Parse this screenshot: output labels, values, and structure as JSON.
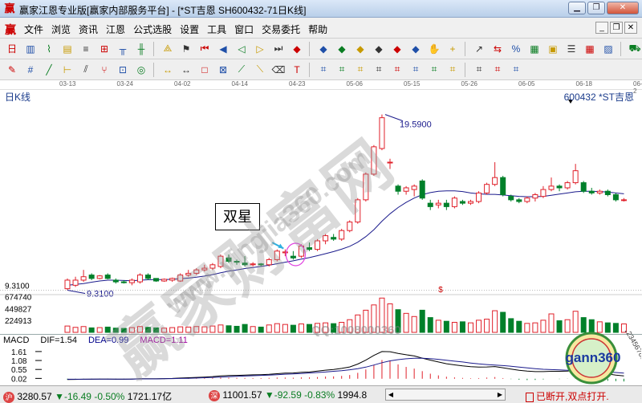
{
  "window": {
    "title": "赢家江恩专业版[赢家内部服务平台] - [*ST吉恩  SH600432-71日K线]",
    "app_icon": "赢"
  },
  "menu": {
    "logo": "赢",
    "items": [
      "文件",
      "浏览",
      "资讯",
      "江恩",
      "公式选股",
      "设置",
      "工具",
      "窗口",
      "交易委托",
      "帮助"
    ]
  },
  "toolbar1_icons": [
    "period-selector-icon",
    "candle-icon",
    "line-chart-icon",
    "indicator-icon",
    "stack-icon",
    "multi-chart-icon",
    "tower-icon",
    "bar-icon",
    "gann-fan-icon",
    "flag-icon",
    "first-icon",
    "prev-icon",
    "play-back-icon",
    "play-icon",
    "next-icon",
    "diamond-icon",
    "diamond-icon",
    "diamond-icon",
    "diamond-icon",
    "diamond-icon",
    "diamond-icon",
    "diamond-icon",
    "hand-icon",
    "crosshair-icon",
    "trend-icon",
    "compare-icon",
    "percent-icon",
    "calculator-icon",
    "report-icon",
    "list-icon",
    "table-icon",
    "chart-icon",
    "truck-icon"
  ],
  "toolbar2_icons": [
    "pencil-icon",
    "grid-icon",
    "line-tool-icon",
    "ruler-icon",
    "channel-icon",
    "fork-icon",
    "gann-square-icon",
    "circle-grid-icon",
    "arrow-tool-icon",
    "arrow-tool-icon",
    "square-icon",
    "gann-box-icon",
    "fan-icon",
    "diagonal-icon",
    "eraser-icon",
    "text-icon",
    "draw-icon",
    "draw-icon",
    "draw-icon",
    "draw-icon",
    "draw-icon",
    "draw-icon",
    "draw-icon",
    "draw-icon",
    "draw-icon",
    "draw-icon",
    "draw-icon"
  ],
  "dates": [
    "03-13",
    "03-24",
    "04-02",
    "04-14",
    "04-23",
    "05-06",
    "05-15",
    "05-26",
    "06-05",
    "06-18",
    "06-2"
  ],
  "chart_header": {
    "period_label": "日K线",
    "stock_label": "600432 *ST吉恩"
  },
  "price_labels": {
    "high": "19.5900",
    "low": "9.3100",
    "axis_low": "9.3100",
    "marker": "$"
  },
  "volume_axis": [
    "674740",
    "449827",
    "224913"
  ],
  "annotation": "双星",
  "macd": {
    "name": "MACD",
    "dif": "DIF=1.54",
    "dea": "DEA=0.99",
    "macd": "MACD=1.11",
    "axis": [
      "1.61",
      "1.08",
      "0.55",
      "0.02"
    ]
  },
  "status": {
    "sh_index": "3280.57",
    "sh_change": "▼-16.49",
    "sh_pct": "-0.50%",
    "sh_amount": "1721.17亿",
    "sz_index": "11001.57",
    "sz_change": "▼-92.59",
    "sz_pct": "-0.83%",
    "sz_amount": "1994.8",
    "connection": "已断开,双点打开.",
    "sh_icon": "沪",
    "sz_icon": "深"
  },
  "watermarks": {
    "brand": "赢家财富网",
    "url": "www.yingjia360.com",
    "qq": "QQ:1008000360"
  },
  "logo": {
    "text": "gann360",
    "ring_text": "123456789"
  },
  "colors": {
    "up": "#e0202a",
    "down": "#00802a",
    "ma_line": "#1b1b8c",
    "macd_dea": "#1b1b8c",
    "macd_dif": "#000000",
    "macd_bar_pos": "#e0202a",
    "macd_bar_neg": "#00802a",
    "highlight_circle": "#e040e0",
    "arrow": "#30b0e0"
  },
  "chart_data": {
    "type": "candlestick",
    "title": "*ST吉恩 SH600432 日K线",
    "candles": [
      {
        "o": 9.4,
        "c": 9.9,
        "h": 10.0,
        "l": 9.31
      },
      {
        "o": 9.6,
        "c": 9.9,
        "h": 10.1,
        "l": 9.5
      },
      {
        "o": 9.9,
        "c": 10.1,
        "h": 10.5,
        "l": 9.8
      },
      {
        "o": 10.2,
        "c": 10.0,
        "h": 10.3,
        "l": 9.9
      },
      {
        "o": 10.0,
        "c": 10.15,
        "h": 10.2,
        "l": 9.95
      },
      {
        "o": 10.2,
        "c": 10.0,
        "h": 10.3,
        "l": 9.95
      },
      {
        "o": 9.9,
        "c": 9.8,
        "h": 10.0,
        "l": 9.7
      },
      {
        "o": 9.8,
        "c": 9.75,
        "h": 9.9,
        "l": 9.7
      },
      {
        "o": 9.75,
        "c": 9.9,
        "h": 10.0,
        "l": 9.6
      },
      {
        "o": 9.8,
        "c": 10.2,
        "h": 10.3,
        "l": 9.7
      },
      {
        "o": 10.2,
        "c": 10.0,
        "h": 10.3,
        "l": 9.9
      },
      {
        "o": 10.0,
        "c": 9.85,
        "h": 10.0,
        "l": 9.8
      },
      {
        "o": 9.85,
        "c": 9.95,
        "h": 10.0,
        "l": 9.8
      },
      {
        "o": 9.9,
        "c": 10.0,
        "h": 10.05,
        "l": 9.8
      },
      {
        "o": 9.85,
        "c": 10.2,
        "h": 10.3,
        "l": 9.8
      },
      {
        "o": 10.2,
        "c": 10.3,
        "h": 10.5,
        "l": 10.1
      },
      {
        "o": 10.3,
        "c": 10.5,
        "h": 10.6,
        "l": 10.2
      },
      {
        "o": 10.5,
        "c": 10.6,
        "h": 10.8,
        "l": 10.4
      },
      {
        "o": 10.6,
        "c": 10.8,
        "h": 10.9,
        "l": 10.5
      },
      {
        "o": 10.7,
        "c": 11.3,
        "h": 11.4,
        "l": 10.6
      },
      {
        "o": 11.2,
        "c": 11.0,
        "h": 11.4,
        "l": 10.9
      },
      {
        "o": 11.0,
        "c": 10.95,
        "h": 11.1,
        "l": 10.8
      },
      {
        "o": 10.9,
        "c": 10.8,
        "h": 11.3,
        "l": 10.7
      },
      {
        "o": 10.8,
        "c": 10.85,
        "h": 10.95,
        "l": 10.7
      },
      {
        "o": 10.85,
        "c": 10.8,
        "h": 10.9,
        "l": 10.7
      },
      {
        "o": 10.8,
        "c": 11.1,
        "h": 11.2,
        "l": 10.7
      },
      {
        "o": 11.1,
        "c": 11.6,
        "h": 11.7,
        "l": 11.0
      },
      {
        "o": 11.5,
        "c": 11.55,
        "h": 11.7,
        "l": 11.3
      },
      {
        "o": 11.3,
        "c": 11.2,
        "h": 11.6,
        "l": 11.1
      },
      {
        "o": 11.3,
        "c": 11.9,
        "h": 12.0,
        "l": 11.2
      },
      {
        "o": 11.8,
        "c": 11.7,
        "h": 12.1,
        "l": 11.6
      },
      {
        "o": 11.7,
        "c": 12.2,
        "h": 12.3,
        "l": 11.6
      },
      {
        "o": 12.2,
        "c": 12.5,
        "h": 12.6,
        "l": 12.0
      },
      {
        "o": 12.4,
        "c": 12.3,
        "h": 12.6,
        "l": 12.2
      },
      {
        "o": 12.3,
        "c": 12.8,
        "h": 12.9,
        "l": 12.2
      },
      {
        "o": 12.8,
        "c": 13.3,
        "h": 13.4,
        "l": 12.7
      },
      {
        "o": 13.3,
        "c": 14.6,
        "h": 14.7,
        "l": 13.2
      },
      {
        "o": 14.6,
        "c": 16.1,
        "h": 16.2,
        "l": 14.5
      },
      {
        "o": 16.1,
        "c": 17.7,
        "h": 17.8,
        "l": 16.0
      },
      {
        "o": 17.6,
        "c": 19.4,
        "h": 19.59,
        "l": 17.5
      },
      {
        "o": 16.8,
        "c": 16.8,
        "h": 17.0,
        "l": 16.4
      },
      {
        "o": 15.4,
        "c": 15.1,
        "h": 15.5,
        "l": 14.9
      },
      {
        "o": 15.1,
        "c": 15.3,
        "h": 15.4,
        "l": 14.9
      },
      {
        "o": 15.2,
        "c": 15.4,
        "h": 15.5,
        "l": 14.8
      },
      {
        "o": 15.7,
        "c": 14.7,
        "h": 15.8,
        "l": 14.6
      },
      {
        "o": 14.4,
        "c": 14.2,
        "h": 14.6,
        "l": 14.0
      },
      {
        "o": 14.3,
        "c": 14.4,
        "h": 14.6,
        "l": 14.1
      },
      {
        "o": 14.4,
        "c": 14.2,
        "h": 14.6,
        "l": 14.0
      },
      {
        "o": 14.2,
        "c": 14.7,
        "h": 14.8,
        "l": 14.1
      },
      {
        "o": 14.5,
        "c": 14.4,
        "h": 14.6,
        "l": 14.3
      },
      {
        "o": 14.4,
        "c": 14.5,
        "h": 14.6,
        "l": 14.3
      },
      {
        "o": 14.5,
        "c": 15.0,
        "h": 15.1,
        "l": 14.4
      },
      {
        "o": 15.0,
        "c": 15.5,
        "h": 15.6,
        "l": 14.9
      },
      {
        "o": 15.5,
        "c": 15.9,
        "h": 16.8,
        "l": 15.4
      },
      {
        "o": 15.9,
        "c": 14.9,
        "h": 16.0,
        "l": 14.8
      },
      {
        "o": 14.8,
        "c": 14.6,
        "h": 14.9,
        "l": 14.5
      },
      {
        "o": 14.6,
        "c": 14.5,
        "h": 14.7,
        "l": 14.4
      },
      {
        "o": 14.5,
        "c": 14.7,
        "h": 14.8,
        "l": 14.4
      },
      {
        "o": 14.7,
        "c": 14.9,
        "h": 15.0,
        "l": 14.5
      },
      {
        "o": 14.8,
        "c": 15.2,
        "h": 15.4,
        "l": 14.7
      },
      {
        "o": 15.2,
        "c": 15.4,
        "h": 15.9,
        "l": 15.1
      },
      {
        "o": 15.4,
        "c": 15.3,
        "h": 15.5,
        "l": 15.1
      },
      {
        "o": 15.3,
        "c": 15.6,
        "h": 15.7,
        "l": 15.2
      },
      {
        "o": 15.6,
        "c": 16.3,
        "h": 16.7,
        "l": 15.5
      },
      {
        "o": 15.6,
        "c": 15.1,
        "h": 15.7,
        "l": 15.0
      },
      {
        "o": 15.1,
        "c": 15.0,
        "h": 15.3,
        "l": 14.9
      },
      {
        "o": 15.0,
        "c": 15.1,
        "h": 15.2,
        "l": 14.9
      },
      {
        "o": 15.1,
        "c": 14.9,
        "h": 15.2,
        "l": 14.8
      },
      {
        "o": 14.9,
        "c": 14.6,
        "h": 15.0,
        "l": 14.5
      },
      {
        "o": 14.6,
        "c": 14.6,
        "h": 14.7,
        "l": 14.5
      }
    ],
    "volume": [
      120000,
      95000,
      110000,
      85000,
      90000,
      100000,
      80000,
      75000,
      90000,
      110000,
      95000,
      85000,
      80000,
      90000,
      105000,
      100000,
      110000,
      105000,
      120000,
      140000,
      125000,
      115000,
      150000,
      110000,
      100000,
      140000,
      165000,
      150000,
      135000,
      160000,
      150000,
      170000,
      180000,
      165000,
      190000,
      240000,
      330000,
      420000,
      520000,
      650000,
      540000,
      430000,
      360000,
      300000,
      420000,
      280000,
      230000,
      210000,
      190000,
      200000,
      180000,
      230000,
      250000,
      410000,
      380000,
      260000,
      210000,
      170000,
      180000,
      230000,
      350000,
      220000,
      240000,
      400000,
      280000,
      240000,
      200000,
      180000,
      170000,
      160000
    ],
    "macd_bars": [
      -0.05,
      -0.04,
      -0.03,
      -0.04,
      -0.03,
      -0.04,
      -0.05,
      -0.04,
      -0.03,
      -0.02,
      -0.02,
      -0.03,
      -0.02,
      -0.01,
      0.01,
      0.02,
      0.03,
      0.04,
      0.05,
      0.07,
      0.06,
      0.05,
      0.05,
      0.04,
      0.04,
      0.05,
      0.07,
      0.07,
      0.06,
      0.08,
      0.08,
      0.1,
      0.13,
      0.14,
      0.17,
      0.22,
      0.35,
      0.55,
      0.8,
      1.11,
      1.05,
      0.85,
      0.7,
      0.6,
      0.45,
      0.3,
      0.2,
      0.12,
      0.08,
      0.05,
      0.03,
      0.04,
      0.07,
      0.1,
      0.04,
      -0.02,
      -0.06,
      -0.08,
      -0.07,
      -0.04,
      0.0,
      -0.02,
      -0.01,
      0.05,
      -0.02,
      -0.06,
      -0.09,
      -0.12,
      -0.14,
      -0.16
    ],
    "dif": [
      -0.05,
      -0.04,
      -0.03,
      -0.03,
      -0.02,
      -0.02,
      -0.03,
      -0.03,
      -0.02,
      0.0,
      0.0,
      0.0,
      0.01,
      0.02,
      0.04,
      0.06,
      0.08,
      0.1,
      0.13,
      0.17,
      0.19,
      0.2,
      0.22,
      0.23,
      0.24,
      0.26,
      0.3,
      0.33,
      0.34,
      0.38,
      0.4,
      0.45,
      0.51,
      0.55,
      0.61,
      0.7,
      0.87,
      1.1,
      1.38,
      1.61,
      1.6,
      1.5,
      1.42,
      1.35,
      1.22,
      1.1,
      0.99,
      0.89,
      0.82,
      0.76,
      0.71,
      0.69,
      0.7,
      0.72,
      0.65,
      0.57,
      0.5,
      0.45,
      0.42,
      0.42,
      0.44,
      0.44,
      0.45,
      0.5,
      0.45,
      0.4,
      0.34,
      0.28,
      0.22,
      0.17
    ],
    "dea": [
      -0.03,
      -0.03,
      -0.03,
      -0.02,
      -0.02,
      -0.02,
      -0.02,
      -0.02,
      -0.02,
      -0.01,
      -0.01,
      -0.01,
      0.0,
      0.01,
      0.02,
      0.03,
      0.04,
      0.06,
      0.08,
      0.1,
      0.12,
      0.14,
      0.16,
      0.18,
      0.2,
      0.22,
      0.24,
      0.27,
      0.29,
      0.31,
      0.34,
      0.37,
      0.4,
      0.44,
      0.48,
      0.53,
      0.6,
      0.69,
      0.81,
      0.95,
      1.06,
      1.13,
      1.18,
      1.21,
      1.21,
      1.19,
      1.15,
      1.09,
      1.04,
      0.99,
      0.93,
      0.88,
      0.84,
      0.81,
      0.78,
      0.74,
      0.69,
      0.64,
      0.6,
      0.56,
      0.54,
      0.52,
      0.5,
      0.5,
      0.49,
      0.47,
      0.44,
      0.41,
      0.37,
      0.33
    ],
    "ma": [
      9.6,
      9.65,
      9.7,
      9.78,
      9.85,
      9.9,
      9.9,
      9.88,
      9.86,
      9.9,
      9.92,
      9.93,
      9.93,
      9.95,
      9.98,
      10.02,
      10.07,
      10.14,
      10.22,
      10.33,
      10.43,
      10.5,
      10.58,
      10.64,
      10.7,
      10.77,
      10.86,
      10.95,
      11.03,
      11.13,
      11.22,
      11.33,
      11.45,
      11.57,
      11.71,
      11.88,
      12.12,
      12.45,
      12.85,
      13.35,
      13.78,
      14.15,
      14.45,
      14.7,
      14.9,
      15.02,
      15.1,
      15.12,
      15.12,
      15.08,
      15.0,
      14.95,
      14.92,
      14.92,
      14.88,
      14.84,
      14.8,
      14.78,
      14.78,
      14.8,
      14.86,
      14.93,
      15.0,
      15.07,
      15.1,
      15.1,
      15.08,
      15.05,
      15.0,
      14.95
    ]
  }
}
